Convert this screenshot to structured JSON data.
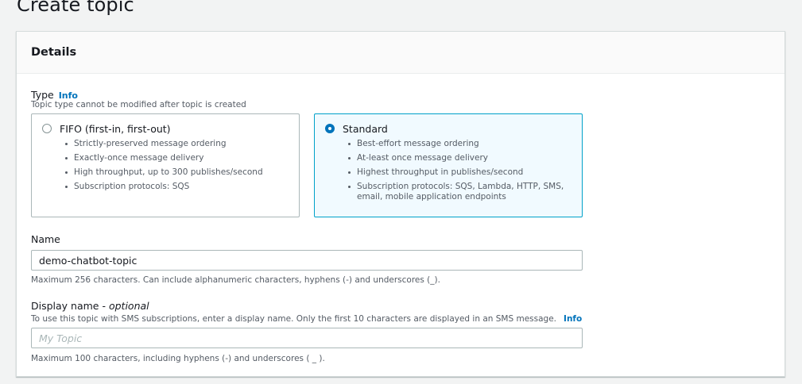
{
  "page": {
    "title": "Create topic"
  },
  "details": {
    "title": "Details",
    "type": {
      "label": "Type",
      "info": "Info",
      "description": "Topic type cannot be modified after topic is created",
      "options": [
        {
          "title": "FIFO (first-in, first-out)",
          "selected": false,
          "bullets": [
            "Strictly-preserved message ordering",
            "Exactly-once message delivery",
            "High throughput, up to 300 publishes/second",
            "Subscription protocols: SQS"
          ]
        },
        {
          "title": "Standard",
          "selected": true,
          "bullets": [
            "Best-effort message ordering",
            "At-least once message delivery",
            "Highest throughput in publishes/second",
            "Subscription protocols: SQS, Lambda, HTTP, SMS, email, mobile application endpoints"
          ]
        }
      ]
    },
    "name": {
      "label": "Name",
      "value": "demo-chatbot-topic",
      "constraint": "Maximum 256 characters. Can include alphanumeric characters, hyphens (-) and underscores (_)."
    },
    "display_name": {
      "label": "Display name",
      "optional": "optional",
      "description": "To use this topic with SMS subscriptions, enter a display name. Only the first 10 characters are displayed in an SMS message.",
      "info": "Info",
      "placeholder": "My Topic",
      "value": "",
      "constraint": "Maximum 100 characters, including hyphens (-) and underscores ( _ )."
    }
  }
}
